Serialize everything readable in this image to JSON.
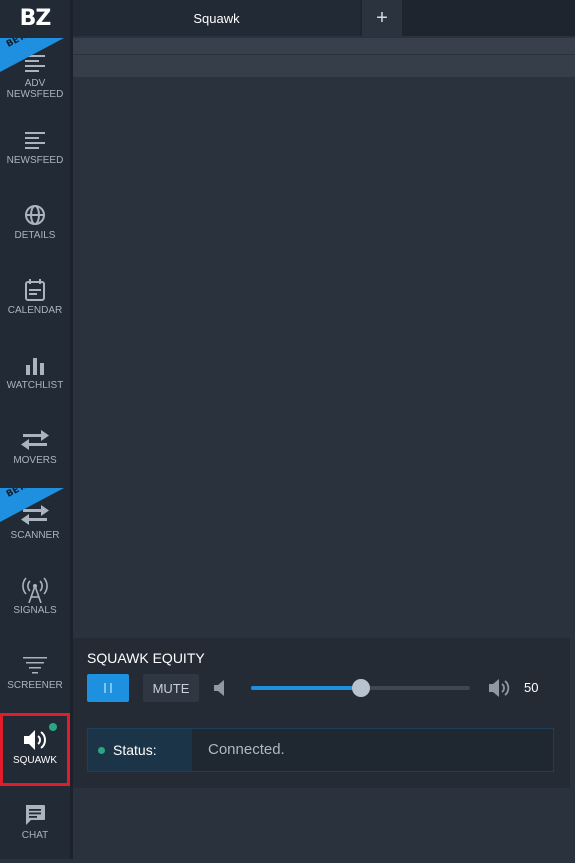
{
  "logo": "BZ",
  "tabs": {
    "active_label": "Squawk",
    "add_label": "+"
  },
  "sidebar": {
    "items": [
      {
        "label": "ADV NEWSFEED",
        "icon": "list-icon",
        "beta": true
      },
      {
        "label": "NEWSFEED",
        "icon": "list-icon"
      },
      {
        "label": "DETAILS",
        "icon": "globe-icon"
      },
      {
        "label": "CALENDAR",
        "icon": "calendar-icon"
      },
      {
        "label": "WATCHLIST",
        "icon": "bar-chart-icon"
      },
      {
        "label": "MOVERS",
        "icon": "swap-arrows-icon"
      },
      {
        "label": "SCANNER",
        "icon": "swap-arrows-icon",
        "beta": true
      },
      {
        "label": "SIGNALS",
        "icon": "antenna-icon"
      },
      {
        "label": "SCREENER",
        "icon": "filter-icon"
      },
      {
        "label": "SQUAWK",
        "icon": "speaker-icon",
        "active": true
      },
      {
        "label": "CHAT",
        "icon": "chat-icon"
      }
    ],
    "beta_label": "BETA"
  },
  "squawk": {
    "title": "SQUAWK EQUITY",
    "mute_label": "MUTE",
    "volume": 50,
    "volume_label": "50",
    "status_label": "Status:",
    "status_value": "Connected."
  },
  "colors": {
    "accent": "#1e90e0",
    "active_border": "#e11d2b",
    "status_green": "#2aa782"
  }
}
